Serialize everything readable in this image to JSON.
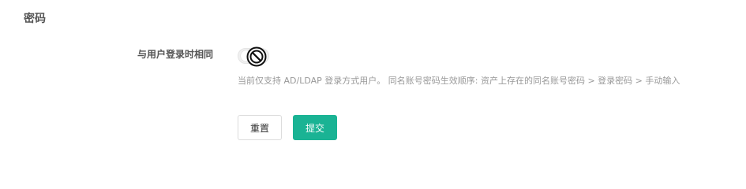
{
  "section": {
    "title": "密码"
  },
  "form": {
    "same_as_login_label": "与用户登录时相同",
    "toggle_enabled": false,
    "toggle_disabled_icon": "no-entry-icon",
    "help_text": "当前仅支持 AD/LDAP 登录方式用户。 同名账号密码生效顺序: 资产上存在的同名账号密码 > 登录密码 > 手动输入"
  },
  "actions": {
    "reset_label": "重置",
    "submit_label": "提交"
  },
  "colors": {
    "primary": "#1ab394",
    "muted_text": "#999999",
    "label_text": "#555555"
  }
}
